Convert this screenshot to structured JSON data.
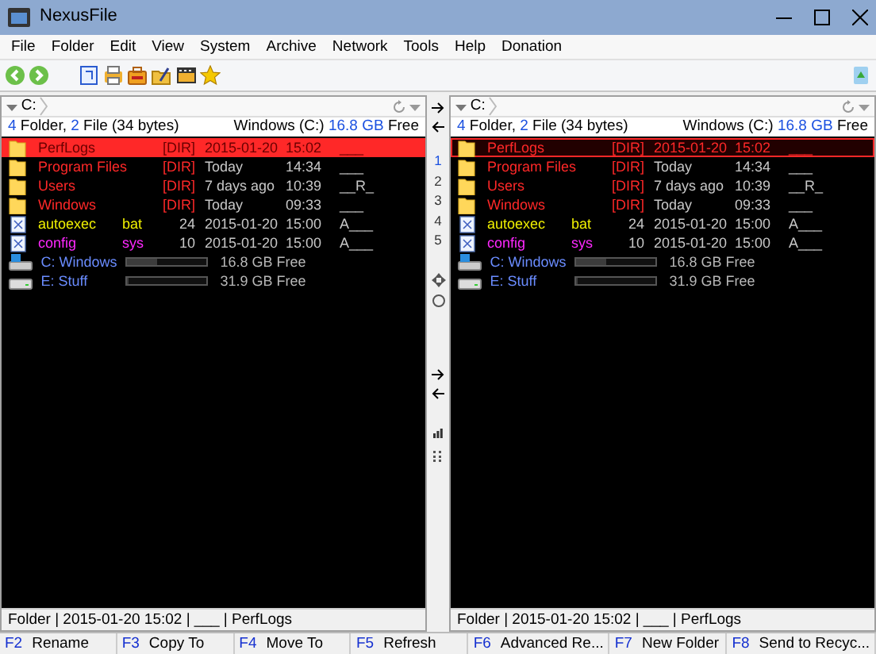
{
  "window": {
    "title": "NexusFile"
  },
  "menu": [
    "File",
    "Folder",
    "Edit",
    "View",
    "System",
    "Archive",
    "Network",
    "Tools",
    "Help",
    "Donation"
  ],
  "panels": [
    {
      "active": true,
      "path": "C:",
      "summary": {
        "folders": "4",
        "folder_label": " Folder, ",
        "files": "2",
        "file_label": " File (34 bytes)",
        "drive": "Windows (C:) ",
        "free": "16.8 GB",
        "free_label": " Free"
      },
      "rows": [
        {
          "kind": "folder",
          "name": "PerfLogs",
          "size": "[DIR]",
          "date": "2015-01-20",
          "time": "15:02",
          "attr": "___",
          "color": "#ff2828",
          "selected": true
        },
        {
          "kind": "folder",
          "name": "Program Files",
          "size": "[DIR]",
          "date": "Today",
          "time": "14:34",
          "attr": "___",
          "color": "#ff2828",
          "selected": false
        },
        {
          "kind": "folder",
          "name": "Users",
          "size": "[DIR]",
          "date": "7 days ago",
          "time": "10:39",
          "attr": "__R_",
          "color": "#ff2828",
          "selected": false
        },
        {
          "kind": "folder",
          "name": "Windows",
          "size": "[DIR]",
          "date": "Today",
          "time": "09:33",
          "attr": "___",
          "color": "#ff2828",
          "selected": false
        },
        {
          "kind": "file",
          "name": "autoexec",
          "ext": "bat",
          "size": "24",
          "date": "2015-01-20",
          "time": "15:00",
          "attr": "A___",
          "color": "#f0f000",
          "selected": false
        },
        {
          "kind": "file",
          "name": "config",
          "ext": "sys",
          "size": "10",
          "date": "2015-01-20",
          "time": "15:00",
          "attr": "A___",
          "color": "#ff28ff",
          "selected": false
        },
        {
          "kind": "drive",
          "name": "C: Windows",
          "level": 0.38,
          "free": "16.8 GB Free",
          "color": "#6a8cff"
        },
        {
          "kind": "drive",
          "name": "E: Stuff",
          "level": 0.02,
          "free": "31.9 GB Free",
          "color": "#6a8cff"
        }
      ],
      "status": "Folder | 2015-01-20 15:02 | ___ | PerfLogs"
    },
    {
      "active": false,
      "path": "C:",
      "summary": {
        "folders": "4",
        "folder_label": " Folder, ",
        "files": "2",
        "file_label": " File (34 bytes)",
        "drive": "Windows (C:) ",
        "free": "16.8 GB",
        "free_label": " Free"
      },
      "rows": [
        {
          "kind": "folder",
          "name": "PerfLogs",
          "size": "[DIR]",
          "date": "2015-01-20",
          "time": "15:02",
          "attr": "___",
          "color": "#ff2828",
          "selected": true
        },
        {
          "kind": "folder",
          "name": "Program Files",
          "size": "[DIR]",
          "date": "Today",
          "time": "14:34",
          "attr": "___",
          "color": "#ff2828",
          "selected": false
        },
        {
          "kind": "folder",
          "name": "Users",
          "size": "[DIR]",
          "date": "7 days ago",
          "time": "10:39",
          "attr": "__R_",
          "color": "#ff2828",
          "selected": false
        },
        {
          "kind": "folder",
          "name": "Windows",
          "size": "[DIR]",
          "date": "Today",
          "time": "09:33",
          "attr": "___",
          "color": "#ff2828",
          "selected": false
        },
        {
          "kind": "file",
          "name": "autoexec",
          "ext": "bat",
          "size": "24",
          "date": "2015-01-20",
          "time": "15:00",
          "attr": "A___",
          "color": "#f0f000",
          "selected": false
        },
        {
          "kind": "file",
          "name": "config",
          "ext": "sys",
          "size": "10",
          "date": "2015-01-20",
          "time": "15:00",
          "attr": "A___",
          "color": "#ff28ff",
          "selected": false
        },
        {
          "kind": "drive",
          "name": "C: Windows",
          "level": 0.38,
          "free": "16.8 GB Free",
          "color": "#6a8cff"
        },
        {
          "kind": "drive",
          "name": "E: Stuff",
          "level": 0.02,
          "free": "31.9 GB Free",
          "color": "#6a8cff"
        }
      ],
      "status": "Folder | 2015-01-20 15:02 | ___ | PerfLogs"
    }
  ],
  "middle_tabs": [
    {
      "label": "1",
      "selected": true
    },
    {
      "label": "2",
      "selected": false
    },
    {
      "label": "3",
      "selected": false
    },
    {
      "label": "4",
      "selected": false
    },
    {
      "label": "5",
      "selected": false
    }
  ],
  "function_keys": [
    {
      "key": "F2",
      "action": "Rename"
    },
    {
      "key": "F3",
      "action": "Copy To"
    },
    {
      "key": "F4",
      "action": "Move To"
    },
    {
      "key": "F5",
      "action": "Refresh"
    },
    {
      "key": "F6",
      "action": "Advanced Re..."
    },
    {
      "key": "F7",
      "action": "New Folder"
    },
    {
      "key": "F8",
      "action": "Send to Recyc..."
    }
  ]
}
